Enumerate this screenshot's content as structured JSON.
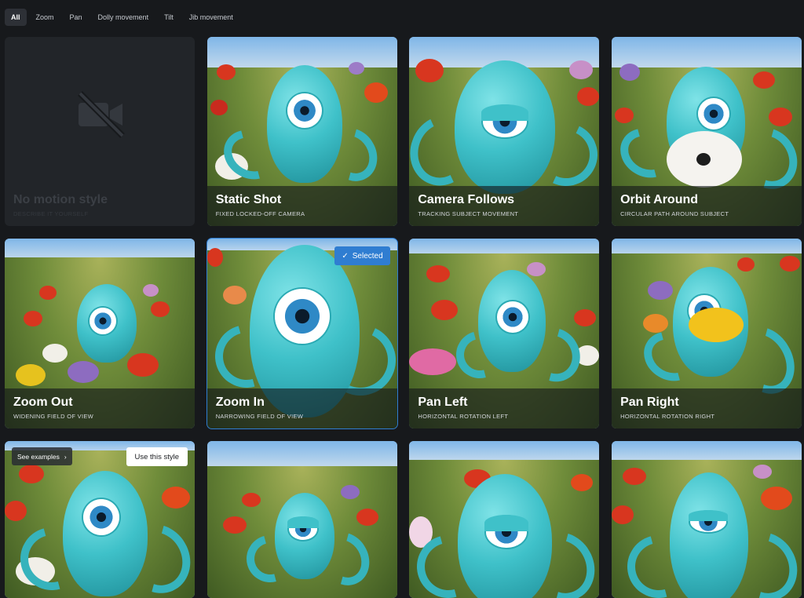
{
  "tabs": [
    {
      "label": "All",
      "active": true
    },
    {
      "label": "Zoom",
      "active": false
    },
    {
      "label": "Pan",
      "active": false
    },
    {
      "label": "Dolly movement",
      "active": false
    },
    {
      "label": "Tilt",
      "active": false
    },
    {
      "label": "Jib movement",
      "active": false
    }
  ],
  "cards": [
    {
      "title": "No motion style",
      "subtitle": "DESCRIBE IT YOURSELF",
      "icon": "video-off-icon"
    },
    {
      "title": "Static Shot",
      "subtitle": "FIXED LOCKED-OFF CAMERA"
    },
    {
      "title": "Camera Follows",
      "subtitle": "TRACKING SUBJECT MOVEMENT"
    },
    {
      "title": "Orbit Around",
      "subtitle": "CIRCULAR PATH AROUND SUBJECT"
    },
    {
      "title": "Zoom Out",
      "subtitle": "WIDENING FIELD OF VIEW"
    },
    {
      "title": "Zoom In",
      "subtitle": "NARROWING FIELD OF VIEW",
      "selected": true
    },
    {
      "title": "Pan Left",
      "subtitle": "HORIZONTAL ROTATION LEFT"
    },
    {
      "title": "Pan Right",
      "subtitle": "HORIZONTAL ROTATION RIGHT"
    }
  ],
  "selected_badge": "Selected",
  "hover_actions": {
    "see_examples": "See examples",
    "use_style": "Use this style"
  },
  "colors": {
    "accent": "#2f7dd1",
    "background": "#17191c",
    "octopus": "#3fc1c9"
  }
}
